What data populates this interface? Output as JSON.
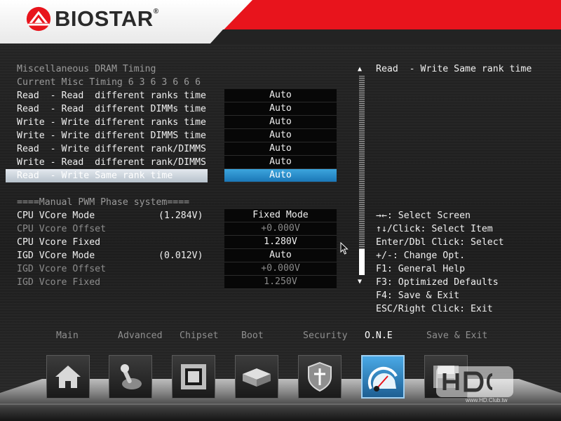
{
  "brand": {
    "name": "BIOSTAR",
    "mark": "®"
  },
  "left_panel": {
    "heading": "Miscellaneous DRAM Timing",
    "current_timing": "Current Misc Timing 6 3 6 3 6 6 6",
    "settings": [
      {
        "label": "Read  - Read  different ranks time",
        "value": "Auto"
      },
      {
        "label": "Read  - Read  different DIMMs time",
        "value": "Auto"
      },
      {
        "label": "Write - Write different ranks time",
        "value": "Auto"
      },
      {
        "label": "Write - Write different DIMMS time",
        "value": "Auto"
      },
      {
        "label": "Read  - Write different rank/DIMMS",
        "value": "Auto"
      },
      {
        "label": "Write - Read  different rank/DIMMS",
        "value": "Auto"
      },
      {
        "label": "Read  - Write Same rank time",
        "value": "Auto",
        "selected": true
      }
    ],
    "pwm_heading": "====Manual PWM Phase system====",
    "power": [
      {
        "label": "CPU VCore Mode",
        "reading": "(1.284V)",
        "value": "Fixed Mode"
      },
      {
        "label": "CPU Vcore Offset",
        "value": "+0.000V",
        "disabled": true
      },
      {
        "label": "CPU Vcore Fixed",
        "value": "1.280V"
      },
      {
        "label": "IGD VCore Mode",
        "reading": "(0.012V)",
        "value": "Auto"
      },
      {
        "label": "IGD Vcore Offset",
        "value": "+0.000V",
        "disabled": true
      },
      {
        "label": "IGD Vcore Fixed",
        "value": "1.250V",
        "disabled": true
      }
    ]
  },
  "help": {
    "description": "Read  - Write Same rank time",
    "keys": [
      "→←: Select Screen",
      "↑↓/Click: Select Item",
      "Enter/Dbl Click: Select",
      "+/-: Change Opt.",
      "F1: General Help",
      "F3: Optimized Defaults",
      "F4: Save & Exit",
      "ESC/Right Click: Exit"
    ]
  },
  "scrollbar": {
    "position": 0.87
  },
  "nav": {
    "tabs": [
      {
        "label": "Main",
        "icon": "home-icon"
      },
      {
        "label": "Advanced",
        "icon": "joystick-icon"
      },
      {
        "label": "Chipset",
        "icon": "chip-icon"
      },
      {
        "label": "Boot",
        "icon": "drive-icon"
      },
      {
        "label": "Security",
        "icon": "shield-icon"
      },
      {
        "label": "O.N.E",
        "icon": "speedometer-icon",
        "active": true
      },
      {
        "label": "Save & Exit",
        "icon": "save-exit-icon"
      }
    ]
  },
  "watermark": {
    "text": "www.HD.Club.tw"
  },
  "colors": {
    "brand_red": "#e8141c",
    "selection_blue": "#2a8ccc",
    "selection_row": "#c5ced6"
  }
}
